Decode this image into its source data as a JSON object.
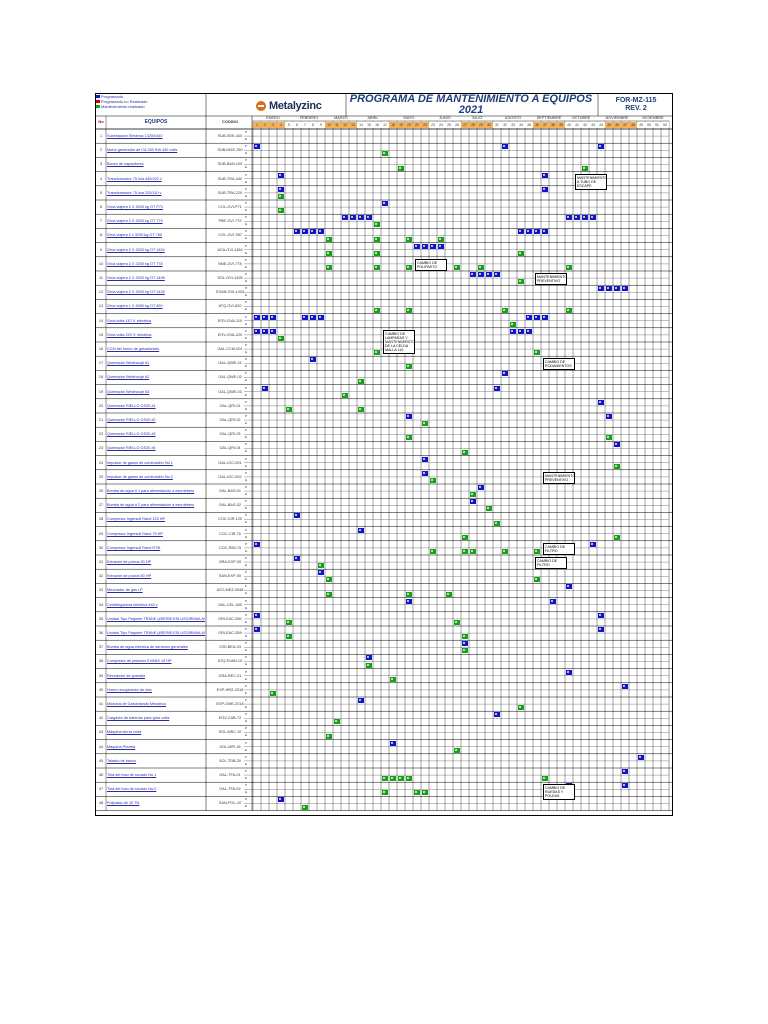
{
  "legend": [
    {
      "label": "Programado",
      "color": "#1414c8"
    },
    {
      "label": "Programado no Realizado",
      "color": "#d00000"
    },
    {
      "label": "Mantenimiento realizado",
      "color": "#17a317"
    }
  ],
  "brand": "Metalyzinc",
  "title_line1": "PROGRAMA DE MANTENIMIENTO A EQUIPOS",
  "title_line2": "2021",
  "form_code": "FOR-MZ-115",
  "form_rev": "REV. 2",
  "head_no": "No",
  "head_equipos": "EQUIPOS",
  "head_codigo": "CODIGO",
  "head_pe": "P/E",
  "months": [
    "ENERO",
    "FEBRERO",
    "MARZO",
    "ABRIL",
    "MAYO",
    "JUNIO",
    "JULIO",
    "AGOSTO",
    "SEPTIEMBRE",
    "OCTUBRE",
    "NOVIEMBRE",
    "DICIEMBRE"
  ],
  "weeks": [
    "1",
    "2",
    "3",
    "4",
    "5",
    "6",
    "7",
    "8",
    "9",
    "10",
    "11",
    "12",
    "13",
    "14",
    "15",
    "16",
    "17",
    "18",
    "19",
    "20",
    "21",
    "22",
    "23",
    "24",
    "25",
    "26",
    "27",
    "28",
    "29",
    "30",
    "31",
    "32",
    "33",
    "34",
    "35",
    "36",
    "37",
    "38",
    "39",
    "40",
    "41",
    "42",
    "43",
    "44",
    "45",
    "46",
    "47",
    "48",
    "49",
    "50",
    "51",
    "52"
  ],
  "equipment": [
    {
      "no": "1",
      "name": "Subestación Eléctrica 13200/440",
      "code": "SUB-SEE-440"
    },
    {
      "no": "2",
      "name": "Motor generador de CA 250 KW 440 volts",
      "code": "SUB-MGE-250"
    },
    {
      "no": "3",
      "name": "Banco de capacitores",
      "code": "SUB-BAN-100"
    },
    {
      "no": "4",
      "name": "Transformador 75 kva 440/220 v",
      "code": "SUB-TRA-440"
    },
    {
      "no": "5",
      "name": "Transformador 75 kva 220/110 v",
      "code": "SUB-TRA-220"
    },
    {
      "no": "6",
      "name": "Grúa viajera 2 X 3200 kg OT P71",
      "code": "COL-GVI-P71"
    },
    {
      "no": "7",
      "name": "Grúa viajera 2 X 3200 kg OT 779",
      "code": "PBE-GVI-779"
    },
    {
      "no": "8",
      "name": "Grúa viajera 2 x 3200 kg OT 780",
      "code": "COL-GVI-780"
    },
    {
      "no": "9",
      "name": "Grúa viajera 2 X 3200 kg OT 1454",
      "code": "ACA-GVI-1454"
    },
    {
      "no": "10",
      "name": "Grúa viajera 2 X 3200 kg OT 778",
      "code": "BNE-GVI-778"
    },
    {
      "no": "11",
      "name": "Grúa viajera 2 X 3200 kg OT 1495",
      "code": "SOL-GVI-1495"
    },
    {
      "no": "12",
      "name": "Grúa viajera 2 X 3200 kg OT 1433",
      "code": "EXAN-GVI-1433"
    },
    {
      "no": "13",
      "name": "Grúa viajera 1 X 3060 kg OT 820",
      "code": "ATQ-GVI-820"
    },
    {
      "no": "14",
      "name": "Grúa volta 110 V. eléctrica",
      "code": "EGV-GVA-110"
    },
    {
      "no": "15",
      "name": "Grúa volta 220 V. eléctrica",
      "code": "EGV-GVA-220"
    },
    {
      "no": "16",
      "name": "CCM del horno de galvanizado",
      "code": "GAL-CCM-001"
    },
    {
      "no": "17",
      "name": "Quemador Weishaupt #1",
      "code": "GAL-QWE-01"
    },
    {
      "no": "18",
      "name": "Quemador Weishaupt #2",
      "code": "GAL-QWE-02"
    },
    {
      "no": "19",
      "name": "Quemador Weishaupt #3",
      "code": "GAL-QWE-03"
    },
    {
      "no": "20",
      "name": "Quemador RIELLO GS20 #1",
      "code": "GAL-QRI-01"
    },
    {
      "no": "21",
      "name": "Quemador RIELLO GS20 #2",
      "code": "GAL-QRI-02"
    },
    {
      "no": "22",
      "name": "Quemador RIELLO GS20 #3",
      "code": "GAL-QRI-03"
    },
    {
      "no": "23",
      "name": "Quemador RIELLO GS20 #4",
      "code": "GAL-QRI-04"
    },
    {
      "no": "24",
      "name": "Impulsor de gases de combustión No.1",
      "code": "GAL-IGC-001"
    },
    {
      "no": "25",
      "name": "Impulsor de gases de combustión No.2",
      "code": "GAL-IGC-002"
    },
    {
      "no": "26",
      "name": "Bomba de agua # 1 para alimentación a escrubbers",
      "code": "GAL-BAS-01"
    },
    {
      "no": "27",
      "name": "Bomba de agua # 2 para alimentación a escrubbers",
      "code": "GAL-BAS-02"
    },
    {
      "no": "28",
      "name": "Compresor Ingersoll Rand 125 HP",
      "code": "COC-CIR-125"
    },
    {
      "no": "29",
      "name": "Compresor Ingersoll Rand 75 HP",
      "code": "COC-CIR-75"
    },
    {
      "no": "30",
      "name": "Compresor Ingersoll Rand R75i",
      "code": "COC-R55-75"
    },
    {
      "no": "31",
      "name": "Extractor de polvos 30 HP",
      "code": "GRA-EXP-30"
    },
    {
      "no": "32",
      "name": "Extractor de polvos 50 HP",
      "code": "SAN-EXP-50"
    },
    {
      "no": "33",
      "name": "Mezclador de gas LP",
      "code": "AZO-MEZ-0048"
    },
    {
      "no": "34",
      "name": "Centrifugadora eléctrica 440 v",
      "code": "GAL-CEL-440"
    },
    {
      "no": "35",
      "name": "Unidad Tipo Paquete TRANE (#SERIE:ESLUS3JRMAA,MOD-WCH180)",
      "code": "ORI-EAC-550"
    },
    {
      "no": "36",
      "name": "Unidad Tipo Paquete TRANE (#SERIE:ESLUS3JRMAA,MOD-WCH180)",
      "code": "ORI-EAC-559"
    },
    {
      "no": "37",
      "name": "Bomba de agua eléctrica de servicios generales",
      "code": "CISI-BEA-03"
    },
    {
      "no": "38",
      "name": "Compresor de pistones EVANS 10 HP",
      "code": "ATQ-EVAN-10"
    },
    {
      "no": "39",
      "name": "Recolector de granalla",
      "code": "GRA-REC-01"
    },
    {
      "no": "40",
      "name": "Horno recuperador de zinc",
      "code": "EXP-HRZ-2018"
    },
    {
      "no": "41",
      "name": "Módulos de Galvanizado Mecánico",
      "code": "EXP-GME-2018"
    },
    {
      "no": "42",
      "name": "Cargador de baterías para grúa volta",
      "code": "EGV-CAB-72"
    },
    {
      "no": "43",
      "name": "Máquina sierra cinta",
      "code": "SOL-MSC-10"
    },
    {
      "no": "44",
      "name": "Máquina Pinzeta",
      "code": "SOL-MPI-15"
    },
    {
      "no": "45",
      "name": "Taladro de banco",
      "code": "SOL-TDB-20"
    },
    {
      "no": "46",
      "name": "Tina del foso de secado No.1",
      "code": "GAL-TFA-01"
    },
    {
      "no": "47",
      "name": "Tina del foso de secado No.2",
      "code": "GAL-TFA-02"
    },
    {
      "no": "48",
      "name": "Polipasto de 10 TN",
      "code": "SAN-POL-10"
    }
  ],
  "pe_p": "P",
  "pe_e": "E",
  "tick": "✓",
  "marks": [
    [
      2,
      0,
      "b",
      32
    ],
    [
      2,
      1,
      "g",
      17
    ],
    [
      2,
      0,
      "b",
      44
    ],
    [
      2,
      0,
      "b",
      1
    ],
    [
      3,
      1,
      "g",
      19
    ],
    [
      3,
      1,
      "g",
      42
    ],
    [
      4,
      0,
      "b",
      37
    ],
    [
      4,
      0,
      "b",
      4
    ],
    [
      5,
      1,
      "g",
      4
    ],
    [
      5,
      0,
      "b",
      4
    ],
    [
      5,
      0,
      "b",
      37
    ],
    [
      6,
      1,
      "g",
      4
    ],
    [
      6,
      0,
      "b",
      17
    ],
    [
      7,
      0,
      "b",
      12
    ],
    [
      7,
      0,
      "b",
      13
    ],
    [
      7,
      0,
      "b",
      14
    ],
    [
      7,
      0,
      "b",
      15
    ],
    [
      7,
      1,
      "g",
      16
    ],
    [
      7,
      0,
      "b",
      40
    ],
    [
      7,
      0,
      "b",
      41
    ],
    [
      7,
      0,
      "b",
      42
    ],
    [
      7,
      0,
      "b",
      43
    ],
    [
      8,
      0,
      "b",
      6
    ],
    [
      8,
      0,
      "b",
      7
    ],
    [
      8,
      0,
      "b",
      8
    ],
    [
      8,
      0,
      "b",
      9
    ],
    [
      8,
      1,
      "g",
      10
    ],
    [
      8,
      1,
      "g",
      16
    ],
    [
      8,
      1,
      "g",
      20
    ],
    [
      8,
      1,
      "g",
      24
    ],
    [
      8,
      0,
      "b",
      34
    ],
    [
      8,
      0,
      "b",
      35
    ],
    [
      8,
      0,
      "b",
      36
    ],
    [
      8,
      0,
      "b",
      37
    ],
    [
      9,
      1,
      "g",
      10
    ],
    [
      9,
      1,
      "g",
      16
    ],
    [
      9,
      0,
      "b",
      21
    ],
    [
      9,
      0,
      "b",
      22
    ],
    [
      9,
      0,
      "b",
      23
    ],
    [
      9,
      0,
      "b",
      24
    ],
    [
      9,
      1,
      "g",
      34
    ],
    [
      10,
      1,
      "g",
      10
    ],
    [
      10,
      1,
      "g",
      16
    ],
    [
      10,
      1,
      "g",
      20
    ],
    [
      10,
      1,
      "g",
      26
    ],
    [
      10,
      1,
      "g",
      29
    ],
    [
      10,
      1,
      "g",
      40
    ],
    [
      11,
      0,
      "b",
      28
    ],
    [
      11,
      0,
      "b",
      29
    ],
    [
      11,
      0,
      "b",
      30
    ],
    [
      11,
      0,
      "b",
      31
    ],
    [
      11,
      1,
      "g",
      34
    ],
    [
      11,
      1,
      "g",
      37
    ],
    [
      12,
      0,
      "b",
      44
    ],
    [
      12,
      0,
      "b",
      45
    ],
    [
      12,
      0,
      "b",
      46
    ],
    [
      12,
      0,
      "b",
      47
    ],
    [
      13,
      1,
      "g",
      16
    ],
    [
      13,
      1,
      "g",
      20
    ],
    [
      13,
      1,
      "g",
      32
    ],
    [
      13,
      1,
      "g",
      40
    ],
    [
      14,
      0,
      "b",
      1
    ],
    [
      14,
      0,
      "b",
      2
    ],
    [
      14,
      0,
      "b",
      3
    ],
    [
      14,
      1,
      "g",
      33
    ],
    [
      14,
      0,
      "b",
      7
    ],
    [
      14,
      0,
      "b",
      8
    ],
    [
      14,
      0,
      "b",
      9
    ],
    [
      14,
      0,
      "b",
      35
    ],
    [
      14,
      0,
      "b",
      36
    ],
    [
      14,
      0,
      "b",
      37
    ],
    [
      15,
      0,
      "b",
      1
    ],
    [
      15,
      0,
      "b",
      2
    ],
    [
      15,
      0,
      "b",
      3
    ],
    [
      15,
      1,
      "g",
      4
    ],
    [
      15,
      0,
      "b",
      33
    ],
    [
      15,
      0,
      "b",
      34
    ],
    [
      15,
      0,
      "b",
      35
    ],
    [
      16,
      1,
      "g",
      36
    ],
    [
      16,
      1,
      "g",
      16
    ],
    [
      17,
      0,
      "b",
      8
    ],
    [
      17,
      1,
      "g",
      20
    ],
    [
      18,
      1,
      "g",
      14
    ],
    [
      18,
      0,
      "b",
      32
    ],
    [
      19,
      0,
      "b",
      2
    ],
    [
      19,
      1,
      "g",
      12
    ],
    [
      19,
      0,
      "b",
      31
    ],
    [
      20,
      1,
      "g",
      5
    ],
    [
      20,
      1,
      "g",
      14
    ],
    [
      20,
      0,
      "b",
      44
    ],
    [
      21,
      0,
      "b",
      20
    ],
    [
      21,
      1,
      "g",
      22
    ],
    [
      21,
      0,
      "b",
      45
    ],
    [
      22,
      1,
      "g",
      20
    ],
    [
      22,
      1,
      "g",
      45
    ],
    [
      23,
      1,
      "g",
      27
    ],
    [
      23,
      0,
      "b",
      46
    ],
    [
      24,
      0,
      "b",
      22
    ],
    [
      24,
      1,
      "g",
      46
    ],
    [
      25,
      1,
      "g",
      23
    ],
    [
      25,
      0,
      "b",
      22
    ],
    [
      26,
      0,
      "b",
      29
    ],
    [
      26,
      1,
      "g",
      28
    ],
    [
      27,
      0,
      "b",
      28
    ],
    [
      27,
      1,
      "g",
      30
    ],
    [
      28,
      1,
      "g",
      31
    ],
    [
      28,
      0,
      "b",
      6
    ],
    [
      29,
      0,
      "b",
      14
    ],
    [
      29,
      1,
      "g",
      46
    ],
    [
      29,
      1,
      "g",
      27
    ],
    [
      30,
      0,
      "b",
      1
    ],
    [
      30,
      1,
      "g",
      23
    ],
    [
      30,
      1,
      "g",
      27
    ],
    [
      30,
      1,
      "g",
      28
    ],
    [
      30,
      1,
      "g",
      32
    ],
    [
      30,
      1,
      "g",
      36
    ],
    [
      30,
      0,
      "b",
      43
    ],
    [
      31,
      0,
      "b",
      6
    ],
    [
      31,
      1,
      "g",
      9
    ],
    [
      31,
      1,
      "g",
      39
    ],
    [
      32,
      1,
      "g",
      10
    ],
    [
      32,
      0,
      "b",
      9
    ],
    [
      32,
      1,
      "g",
      36
    ],
    [
      33,
      1,
      "g",
      10
    ],
    [
      33,
      1,
      "g",
      20
    ],
    [
      33,
      1,
      "g",
      25
    ],
    [
      33,
      0,
      "b",
      40
    ],
    [
      34,
      0,
      "b",
      38
    ],
    [
      34,
      0,
      "b",
      20
    ],
    [
      35,
      0,
      "b",
      1
    ],
    [
      35,
      1,
      "g",
      5
    ],
    [
      35,
      1,
      "g",
      26
    ],
    [
      35,
      0,
      "b",
      44
    ],
    [
      36,
      0,
      "b",
      1
    ],
    [
      36,
      1,
      "g",
      5
    ],
    [
      36,
      1,
      "g",
      27
    ],
    [
      36,
      0,
      "b",
      44
    ],
    [
      37,
      0,
      "b",
      27
    ],
    [
      37,
      1,
      "g",
      27
    ],
    [
      38,
      1,
      "g",
      15
    ],
    [
      38,
      0,
      "b",
      15
    ],
    [
      39,
      1,
      "g",
      18
    ],
    [
      39,
      0,
      "b",
      40
    ],
    [
      40,
      0,
      "b",
      47
    ],
    [
      40,
      1,
      "g",
      3
    ],
    [
      41,
      0,
      "b",
      14
    ],
    [
      41,
      1,
      "g",
      34
    ],
    [
      42,
      1,
      "g",
      11
    ],
    [
      42,
      0,
      "b",
      31
    ],
    [
      43,
      1,
      "g",
      10
    ],
    [
      44,
      0,
      "b",
      18
    ],
    [
      44,
      1,
      "g",
      26
    ],
    [
      45,
      0,
      "b",
      49
    ],
    [
      46,
      1,
      "g",
      17
    ],
    [
      46,
      1,
      "g",
      18
    ],
    [
      46,
      1,
      "g",
      19
    ],
    [
      46,
      1,
      "g",
      20
    ],
    [
      46,
      1,
      "g",
      37
    ],
    [
      46,
      0,
      "b",
      47
    ],
    [
      47,
      1,
      "g",
      17
    ],
    [
      47,
      1,
      "g",
      21
    ],
    [
      47,
      1,
      "g",
      22
    ],
    [
      47,
      0,
      "b",
      40
    ],
    [
      47,
      0,
      "b",
      47
    ],
    [
      48,
      0,
      "b",
      4
    ],
    [
      48,
      1,
      "g",
      7
    ]
  ],
  "notes": [
    {
      "text": "CAMBIO DE LAMPARAS Y MANTENIMIENTO DE LA CELDA MALLA 110",
      "row": 15,
      "col": 17
    },
    {
      "text": "MANTENIMIENTO A TUBO DE ESCAPE",
      "row": 4,
      "col": 41
    },
    {
      "text": "CAMBIO DE POLIPASTO",
      "row": 10,
      "col": 21
    },
    {
      "text": "MANTENIMIENTO PREVENTIVO",
      "row": 11,
      "col": 36
    },
    {
      "text": "CAMBIO DE RODAMIENTOS",
      "row": 17,
      "col": 37
    },
    {
      "text": "MANTENIMIENTO PREVENTIVO",
      "row": 25,
      "col": 37
    },
    {
      "text": "CAMBIO DE FILTRO",
      "row": 30,
      "col": 37
    },
    {
      "text": "CAMBIO DE FILTRO",
      "row": 31,
      "col": 36
    },
    {
      "text": "CAMBIO DE RUEDAS Y POLEAS",
      "row": 47,
      "col": 37
    }
  ]
}
